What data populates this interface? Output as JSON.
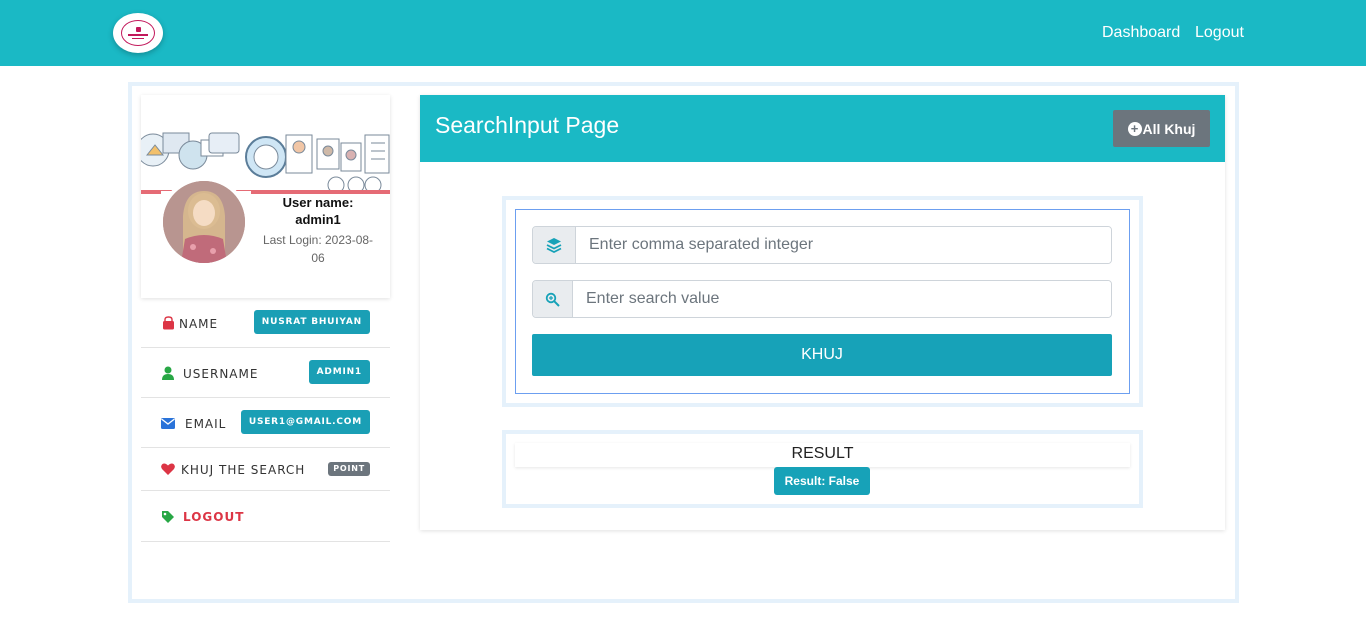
{
  "nav": {
    "dashboard": "Dashboard",
    "logout": "Logout"
  },
  "profile": {
    "username_line1": "User name:",
    "username_line2": "admin1",
    "last_login_label": "Last Login: 2023-08-06"
  },
  "info": {
    "name_label": "NAME",
    "name_value": "NUSRAT BHUIYAN",
    "username_label": "USERNAME",
    "username_value": "ADMIN1",
    "email_label": "EMAIL",
    "email_value": "USER1@GMAIL.COM",
    "khuj_label": "KHUJ THE SEARCH",
    "khuj_badge": "POINT",
    "logout_label": "LOGOUT"
  },
  "panel": {
    "title": "SearchInput Page",
    "all_button": "All Khuj"
  },
  "form": {
    "integers_placeholder": "Enter comma separated integer",
    "search_placeholder": "Enter search value",
    "submit_label": "KHUJ"
  },
  "result": {
    "heading": "RESULT",
    "badge": "Result: False"
  },
  "colors": {
    "primary": "#1ab9c5",
    "button": "#17a2b8",
    "gray": "#6c757d",
    "danger": "#dc3545",
    "success": "#28a745"
  },
  "icons": {
    "name": "bag-icon",
    "username": "user-icon",
    "email": "envelope-icon",
    "khuj": "heart-icon",
    "logout": "tag-icon",
    "integers": "layers-icon",
    "search": "search-icon",
    "all": "plus-circle-icon"
  }
}
